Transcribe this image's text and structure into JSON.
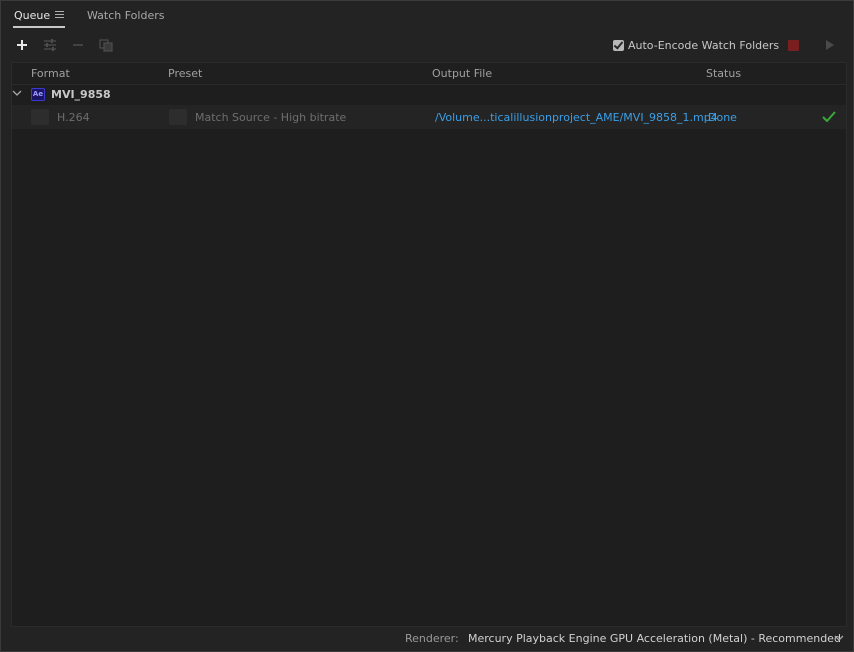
{
  "tabs": {
    "queue_label": "Queue",
    "watch_folders_label": "Watch Folders"
  },
  "toolbar": {
    "add_icon": "plus-icon",
    "settings_icon": "sliders-icon",
    "remove_icon": "minus-icon",
    "duplicate_icon": "duplicate-icon",
    "auto_encode_label": "Auto-Encode Watch Folders",
    "auto_encode_checked": true,
    "stop_color": "#7a1f1f"
  },
  "table": {
    "headers": {
      "format": "Format",
      "preset": "Preset",
      "output": "Output File",
      "status": "Status"
    },
    "group": {
      "badge": "Ae",
      "name": "MVI_9858"
    },
    "item": {
      "format": "H.264",
      "preset": "Match Source - High bitrate",
      "output": "/Volume...ticalillusionproject_AME/MVI_9858_1.mp4",
      "status": "Done",
      "status_color": "#3b9ee6",
      "done_icon": "checkmark-icon",
      "done_color": "#3aa83a"
    }
  },
  "renderer": {
    "label": "Renderer:",
    "value": "Mercury Playback Engine GPU Acceleration (Metal) - Recommended"
  }
}
